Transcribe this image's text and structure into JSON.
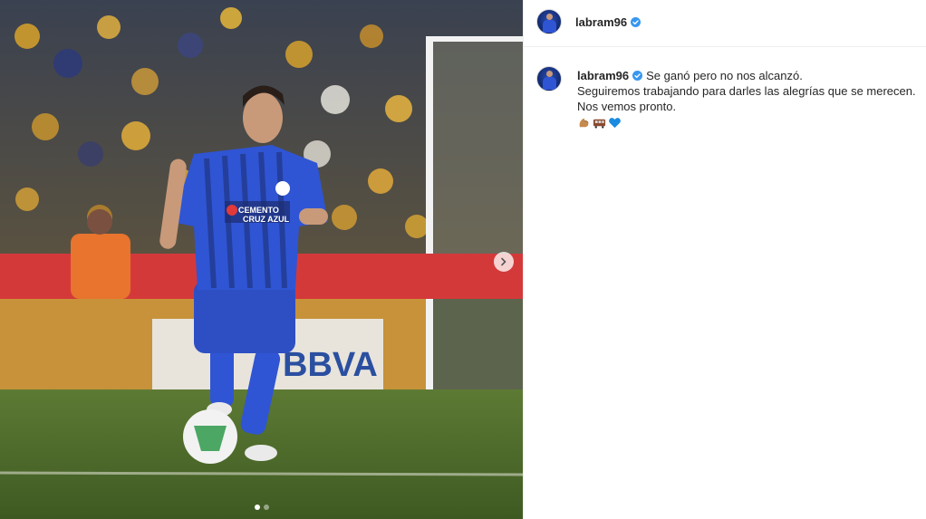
{
  "post": {
    "username": "labram96",
    "verified": true,
    "caption": {
      "line1": "Se ganó pero no nos alcanzó.",
      "line2": "Seguiremos trabajando para darles las alegrías que se merecen.",
      "line3": "Nos vemos pronto.",
      "emojis": [
        "flexed-biceps",
        "train",
        "blue-heart"
      ]
    }
  },
  "photo": {
    "jersey_sponsor_line1": "CEMENTO",
    "jersey_sponsor_line2": "CRUZ AZUL",
    "ad_board_text": "BBVA",
    "carousel": {
      "total": 2,
      "active_index": 1
    }
  },
  "colors": {
    "verified_badge": "#3897f0",
    "jersey_blue": "#2f55d4",
    "pitch_green": "#4c6b2c",
    "board_red": "#d4393a"
  }
}
